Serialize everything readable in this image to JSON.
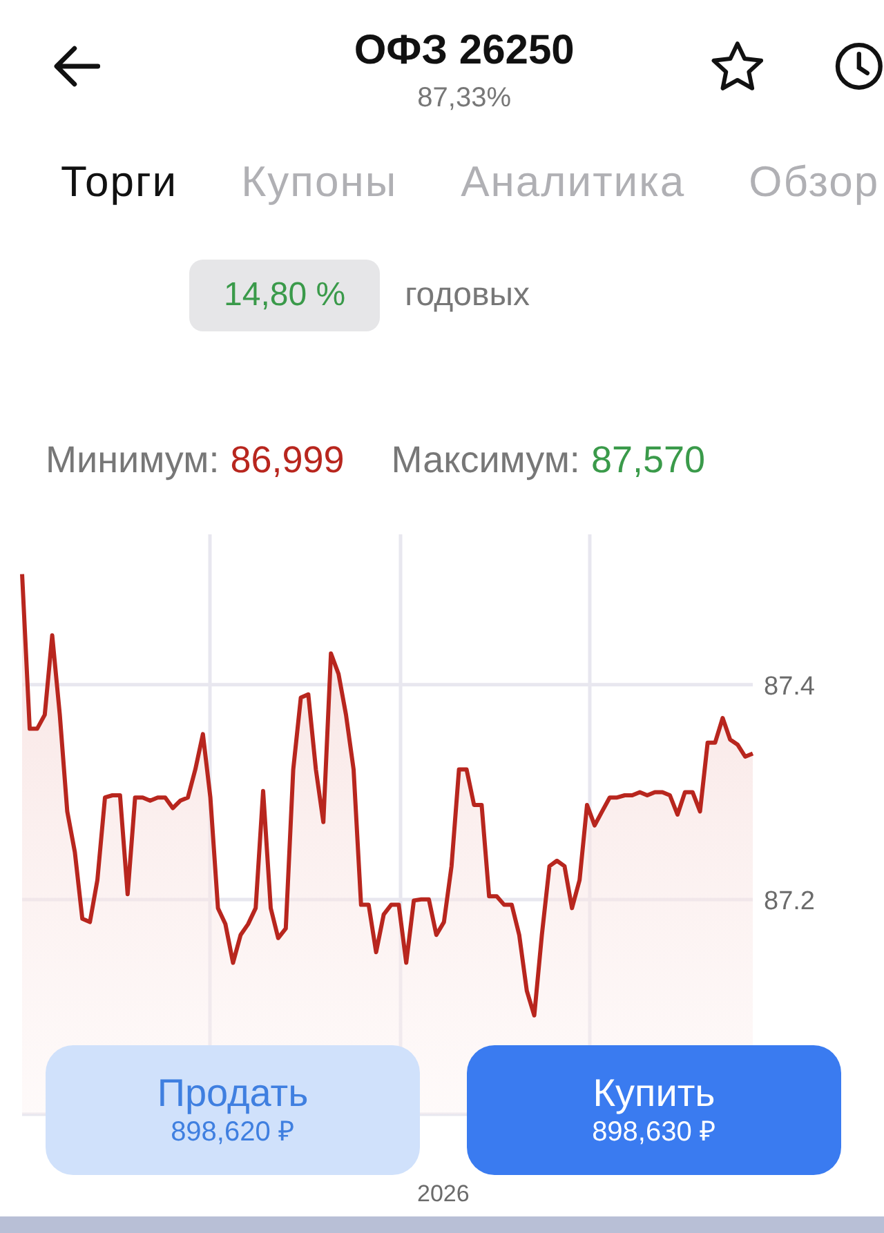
{
  "header": {
    "title": "ОФЗ 26250",
    "subtitle": "87,33%"
  },
  "tabs": [
    {
      "label": "Торги",
      "selected": true
    },
    {
      "label": "Купоны",
      "selected": false
    },
    {
      "label": "Аналитика",
      "selected": false
    },
    {
      "label": "Обзор",
      "selected": false
    }
  ],
  "yield": {
    "value": "14,80 %",
    "label": "годовых"
  },
  "range": {
    "minimum": {
      "label": "Минимум:",
      "value": "86,999"
    },
    "maximum": {
      "label": "Максимум:",
      "value": "87,570"
    }
  },
  "chart": {
    "axis_year": "2026",
    "chart_data": {
      "type": "area",
      "grid": true,
      "ylim": [
        87.0,
        87.54
      ],
      "yticks": [
        87.2,
        87.4
      ],
      "series": [
        {
          "color": "#b8261e",
          "values": [
            87.503,
            87.359,
            87.359,
            87.372,
            87.446,
            87.372,
            87.282,
            87.244,
            87.182,
            87.179,
            87.218,
            87.295,
            87.297,
            87.297,
            87.205,
            87.295,
            87.295,
            87.292,
            87.295,
            87.295,
            87.285,
            87.292,
            87.295,
            87.321,
            87.354,
            87.295,
            87.192,
            87.177,
            87.141,
            87.167,
            87.177,
            87.192,
            87.301,
            87.192,
            87.164,
            87.173,
            87.321,
            87.388,
            87.391,
            87.321,
            87.272,
            87.429,
            87.41,
            87.372,
            87.321,
            87.195,
            87.195,
            87.151,
            87.186,
            87.195,
            87.195,
            87.141,
            87.199,
            87.2,
            87.2,
            87.167,
            87.179,
            87.231,
            87.321,
            87.321,
            87.288,
            87.288,
            87.203,
            87.203,
            87.195,
            87.195,
            87.167,
            87.115,
            87.092,
            87.167,
            87.231,
            87.236,
            87.231,
            87.192,
            87.218,
            87.288,
            87.269,
            87.282,
            87.295,
            87.295,
            87.297,
            87.297,
            87.3,
            87.297,
            87.3,
            87.3,
            87.297,
            87.279,
            87.3,
            87.3,
            87.282,
            87.346,
            87.346,
            87.369,
            87.349,
            87.344,
            87.333,
            87.336
          ]
        }
      ]
    }
  },
  "actions": [
    {
      "kind": "sell",
      "label": "Продать",
      "price": "898,620 ₽"
    },
    {
      "kind": "buy",
      "label": "Купить",
      "price": "898,630 ₽"
    }
  ]
}
